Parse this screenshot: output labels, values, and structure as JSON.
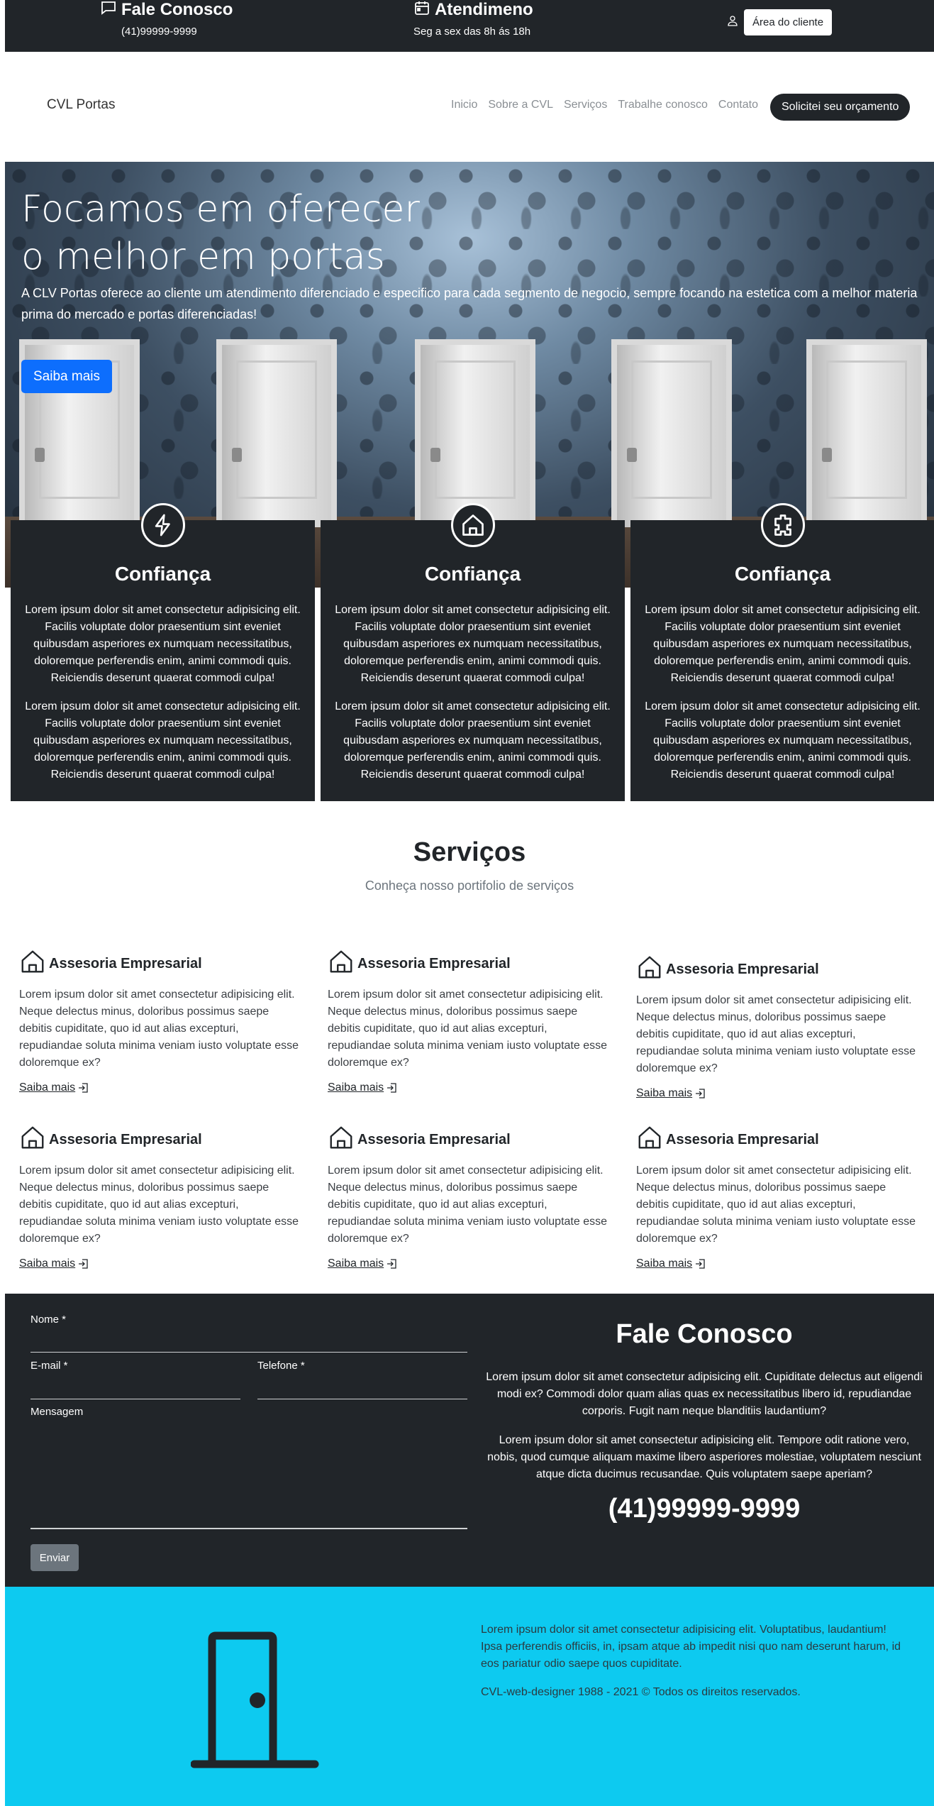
{
  "topbar": {
    "fale": {
      "title": "Fale Conosco",
      "phone": "(41)99999-9999",
      "icon": "chat-icon"
    },
    "atendimento": {
      "title": "Atendimeno",
      "hours": "Seg a sex das 8h ás 18h",
      "icon": "calendar-icon"
    },
    "cliente": {
      "label": "Área do cliente",
      "icon": "person-icon"
    }
  },
  "navbar": {
    "brand": "CVL Portas",
    "links": [
      "Inicio",
      "Sobre a CVL",
      "Serviços",
      "Trabalhe conosco",
      "Contato"
    ],
    "cta": "Solicitei seu orçamento"
  },
  "hero": {
    "title_line1": "Focamos em oferecer",
    "title_line2": "o melhor em portas",
    "text": "A CLV Portas oferece ao cliente um atendimento diferenciado e especifico para cada segmento de negocio, sempre focando na estetica com a melhor materia prima do mercado e portas diferenciadas!",
    "button": "Saiba mais"
  },
  "features": [
    {
      "icon": "lightning-icon",
      "title": "Confiança",
      "p1": "Lorem ipsum dolor sit amet consectetur adipisicing elit. Facilis voluptate dolor praesentium sint eveniet quibusdam asperiores ex numquam necessitatibus, doloremque perferendis enim, animi commodi quis. Reiciendis deserunt quaerat commodi culpa!",
      "p2": "Lorem ipsum dolor sit amet consectetur adipisicing elit. Facilis voluptate dolor praesentium sint eveniet quibusdam asperiores ex numquam necessitatibus, doloremque perferendis enim, animi commodi quis. Reiciendis deserunt quaerat commodi culpa!"
    },
    {
      "icon": "house-icon",
      "title": "Confiança",
      "p1": "Lorem ipsum dolor sit amet consectetur adipisicing elit. Facilis voluptate dolor praesentium sint eveniet quibusdam asperiores ex numquam necessitatibus, doloremque perferendis enim, animi commodi quis. Reiciendis deserunt quaerat commodi culpa!",
      "p2": "Lorem ipsum dolor sit amet consectetur adipisicing elit. Facilis voluptate dolor praesentium sint eveniet quibusdam asperiores ex numquam necessitatibus, doloremque perferendis enim, animi commodi quis. Reiciendis deserunt quaerat commodi culpa!"
    },
    {
      "icon": "plugin-icon",
      "title": "Confiança",
      "p1": "Lorem ipsum dolor sit amet consectetur adipisicing elit. Facilis voluptate dolor praesentium sint eveniet quibusdam asperiores ex numquam necessitatibus, doloremque perferendis enim, animi commodi quis. Reiciendis deserunt quaerat commodi culpa!",
      "p2": "Lorem ipsum dolor sit amet consectetur adipisicing elit. Facilis voluptate dolor praesentium sint eveniet quibusdam asperiores ex numquam necessitatibus, doloremque perferendis enim, animi commodi quis. Reiciendis deserunt quaerat commodi culpa!"
    }
  ],
  "services": {
    "title": "Serviços",
    "subtitle": "Conheça nosso portifolio de serviços",
    "items": [
      {
        "title": "Assesoria Empresarial",
        "text": "Lorem ipsum dolor sit amet consectetur adipisicing elit. Neque delectus minus, doloribus possimus saepe debitis cupiditate, quo id aut alias excepturi, repudiandae soluta minima veniam iusto voluptate esse doloremque ex?",
        "link": "Saiba mais "
      },
      {
        "title": "Assesoria Empresarial",
        "text": "Lorem ipsum dolor sit amet consectetur adipisicing elit. Neque delectus minus, doloribus possimus saepe debitis cupiditate, quo id aut alias excepturi, repudiandae soluta minima veniam iusto voluptate esse doloremque ex?",
        "link": "Saiba mais "
      },
      {
        "title": "Assesoria Empresarial",
        "text": "Lorem ipsum dolor sit amet consectetur adipisicing elit. Neque delectus minus, doloribus possimus saepe debitis cupiditate, quo id aut alias excepturi, repudiandae soluta minima veniam iusto voluptate esse doloremque ex?",
        "link": "Saiba mais "
      },
      {
        "title": "Assesoria Empresarial",
        "text": "Lorem ipsum dolor sit amet consectetur adipisicing elit. Neque delectus minus, doloribus possimus saepe debitis cupiditate, quo id aut alias excepturi, repudiandae soluta minima veniam iusto voluptate esse doloremque ex?",
        "link": "Saiba mais "
      },
      {
        "title": "Assesoria Empresarial",
        "text": "Lorem ipsum dolor sit amet consectetur adipisicing elit. Neque delectus minus, doloribus possimus saepe debitis cupiditate, quo id aut alias excepturi, repudiandae soluta minima veniam iusto voluptate esse doloremque ex?",
        "link": "Saiba mais "
      },
      {
        "title": "Assesoria Empresarial",
        "text": "Lorem ipsum dolor sit amet consectetur adipisicing elit. Neque delectus minus, doloribus possimus saepe debitis cupiditate, quo id aut alias excepturi, repudiandae soluta minima veniam iusto voluptate esse doloremque ex?",
        "link": "Saiba mais "
      }
    ]
  },
  "contact": {
    "form": {
      "nome": "Nome *",
      "email": "E-mail *",
      "telefone": "Telefone *",
      "mensagem": "Mensagem",
      "button": "Enviar"
    },
    "title": "Fale Conosco",
    "p1": "Lorem ipsum dolor sit amet consectetur adipisicing elit. Cupiditate delectus aut eligendi modi ex? Commodi dolor quam alias quas ex necessitatibus libero id, repudiandae corporis. Fugit nam neque blanditiis laudantium?",
    "p2": "Lorem ipsum dolor sit amet consectetur adipisicing elit. Tempore odit ratione vero, nobis, quod cumque aliquam maxime libero asperiores molestiae, voluptatem nesciunt atque dicta ducimus recusandae. Quis voluptatem saepe aperiam?",
    "phone": "(41)99999-9999"
  },
  "footer": {
    "icon": "door-icon",
    "text": "Lorem ipsum dolor sit amet consectetur adipisicing elit. Voluptatibus, laudantium! Ipsa perferendis officiis, in, ipsam atque ab impedit nisi quo nam deserunt harum, id eos pariatur odio saepe quos cupiditate.",
    "copyright": "CVL-web-designer 1988 - 2021 © Todos os direitos reservados."
  },
  "colors": {
    "dark": "#212529",
    "primary": "#0d6efd",
    "footer": "#0dcaf0",
    "secondary": "#6c757d"
  }
}
